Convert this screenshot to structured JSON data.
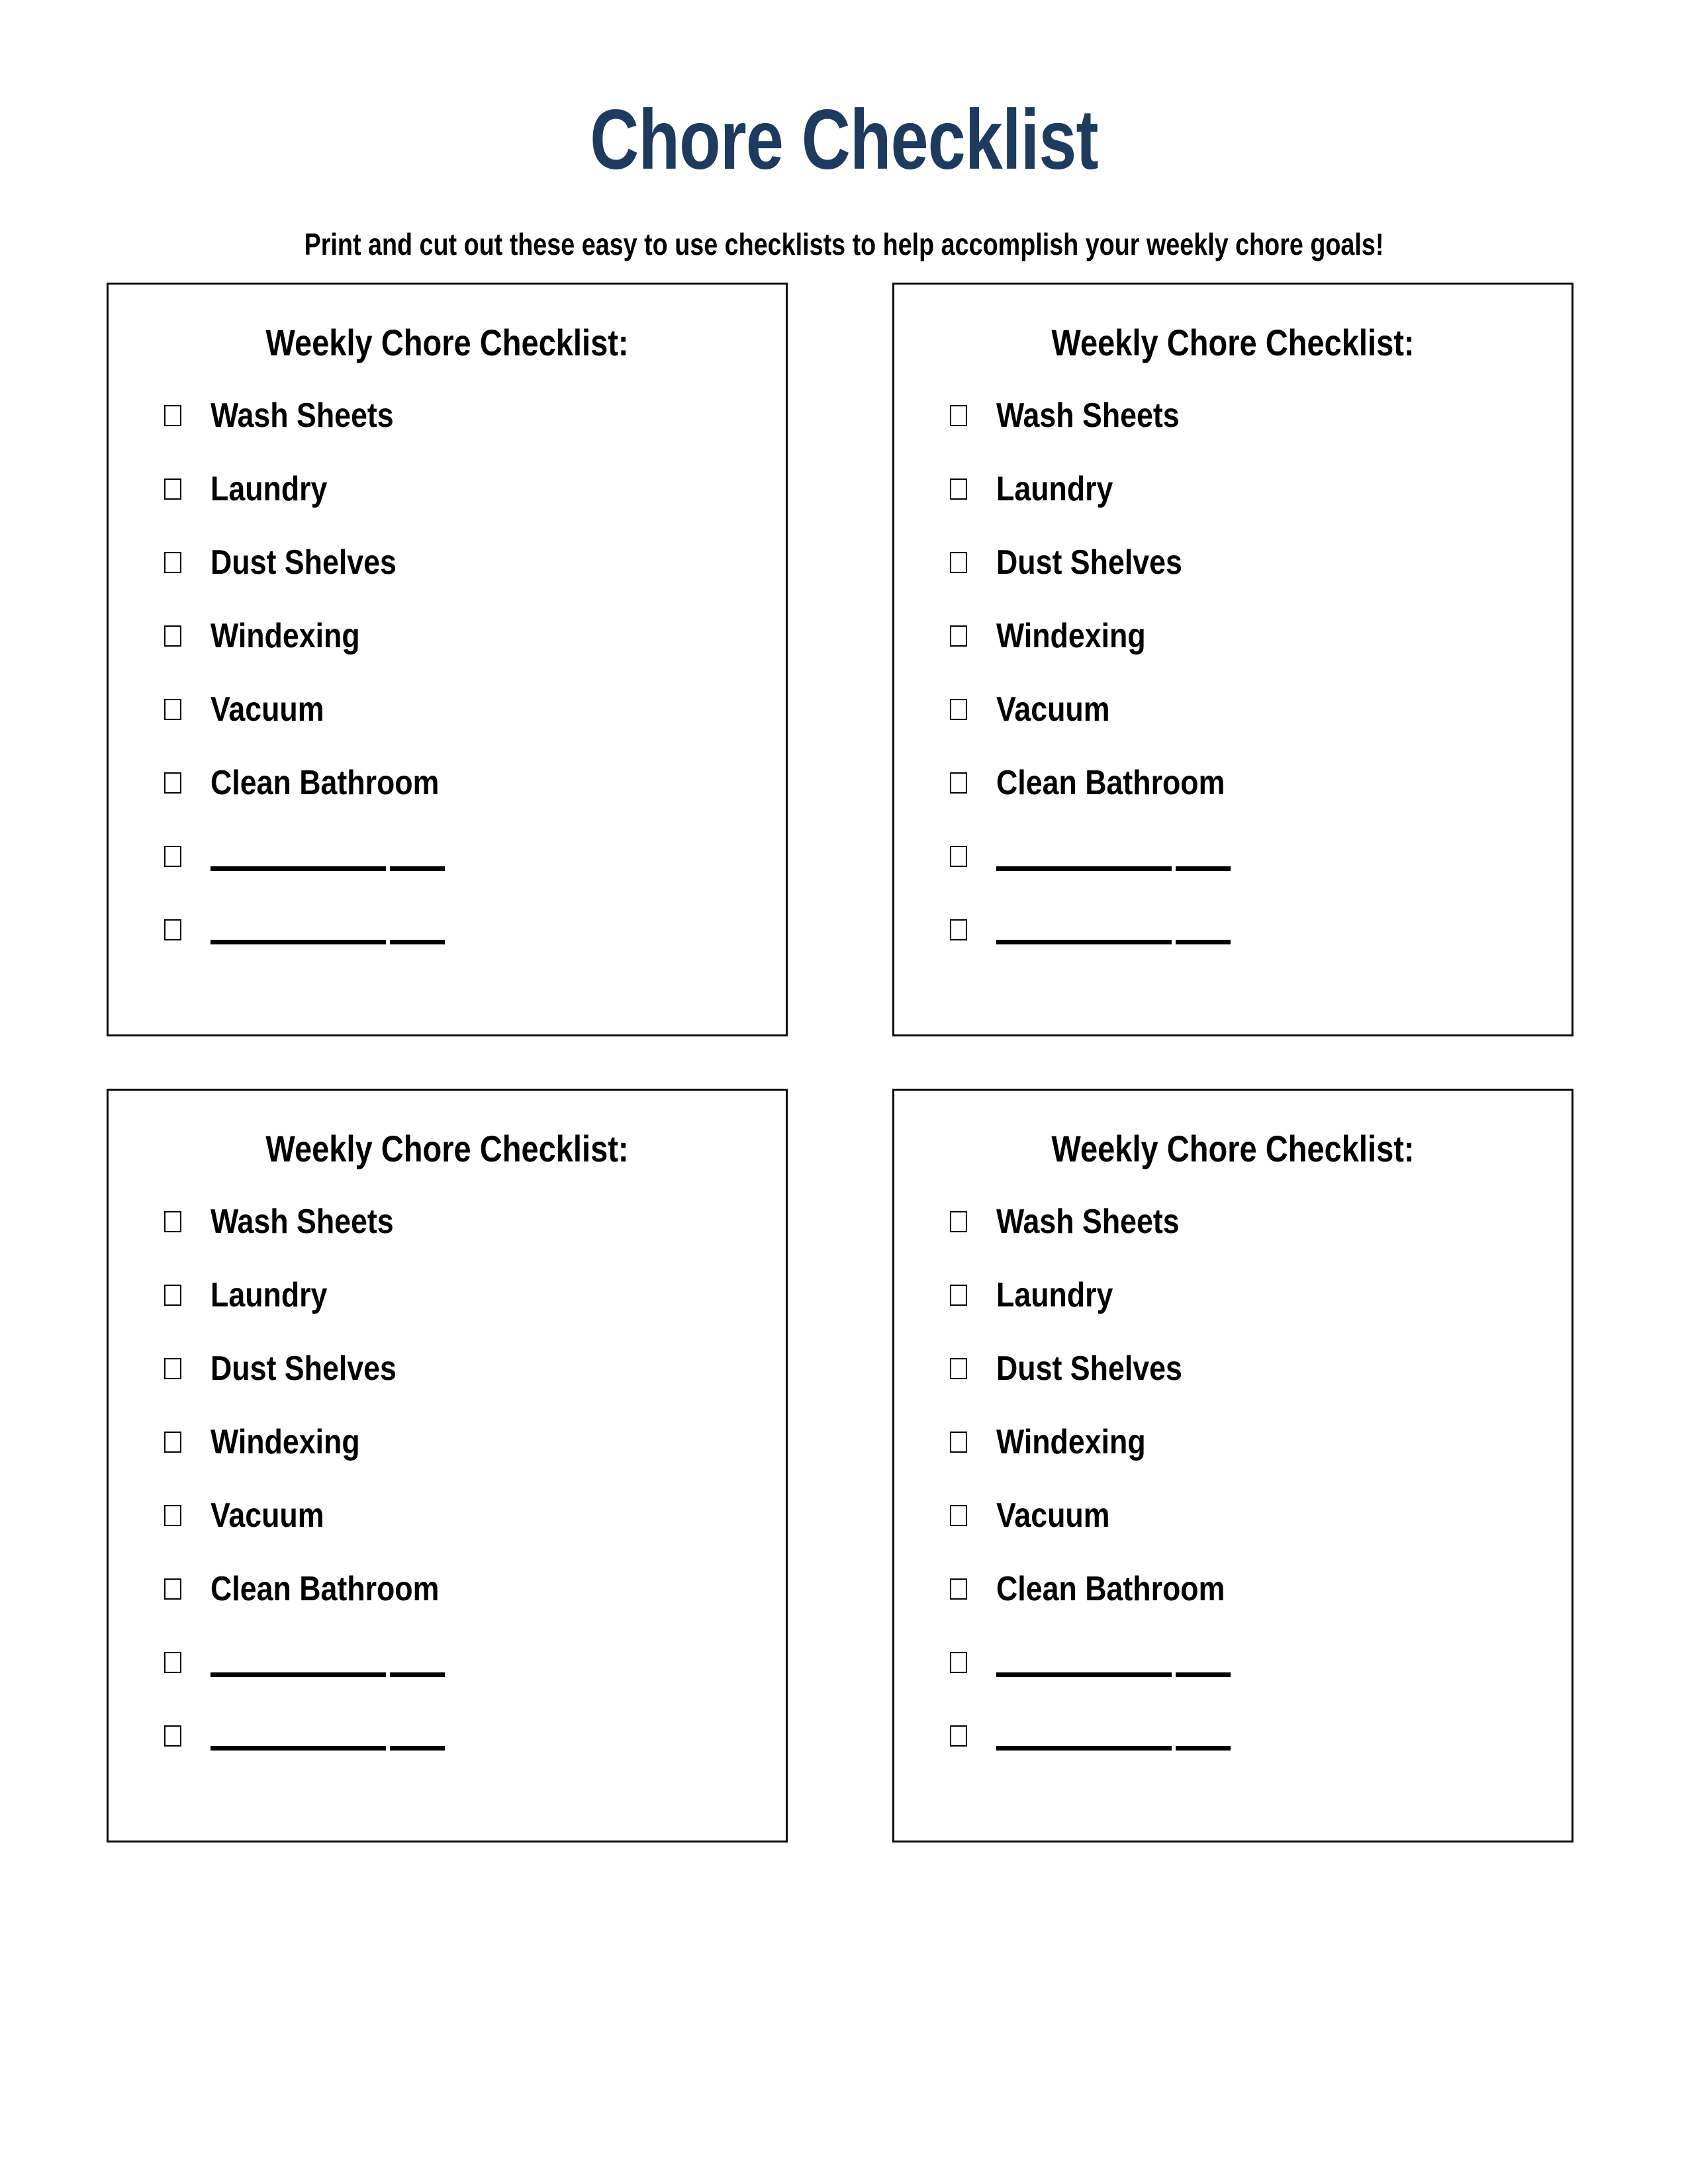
{
  "page": {
    "title": "Chore Checklist",
    "subtitle": "Print and cut out these easy to use checklists to help accomplish your weekly chore goals!",
    "title_color": "#1d3a5f",
    "text_color": "#000000",
    "border_color": "#0a0a0a",
    "background_color": "#ffffff"
  },
  "checklist_template": {
    "heading": "Weekly Chore Checklist:",
    "items": [
      {
        "label": "Wash Sheets",
        "type": "labeled",
        "checked": false
      },
      {
        "label": "Laundry",
        "type": "labeled",
        "checked": false
      },
      {
        "label": "Dust Shelves",
        "type": "labeled",
        "checked": false
      },
      {
        "label": "Windexing",
        "type": "labeled",
        "checked": false
      },
      {
        "label": "Vacuum",
        "type": "labeled",
        "checked": false
      },
      {
        "label": "Clean Bathroom",
        "type": "labeled",
        "checked": false
      },
      {
        "label": "______________",
        "type": "blank",
        "checked": false
      },
      {
        "label": "______________",
        "type": "blank",
        "checked": false
      }
    ]
  },
  "cards": [
    {
      "id": "card-1",
      "heading": "Weekly Chore Checklist:",
      "items": [
        {
          "label": "Wash Sheets"
        },
        {
          "label": "Laundry"
        },
        {
          "label": "Dust Shelves"
        },
        {
          "label": "Windexing"
        },
        {
          "label": "Vacuum"
        },
        {
          "label": "Clean Bathroom"
        },
        {
          "label": ""
        },
        {
          "label": ""
        }
      ]
    },
    {
      "id": "card-2",
      "heading": "Weekly Chore Checklist:",
      "items": [
        {
          "label": "Wash Sheets"
        },
        {
          "label": "Laundry"
        },
        {
          "label": "Dust Shelves"
        },
        {
          "label": "Windexing"
        },
        {
          "label": "Vacuum"
        },
        {
          "label": "Clean Bathroom"
        },
        {
          "label": ""
        },
        {
          "label": ""
        }
      ]
    },
    {
      "id": "card-3",
      "heading": "Weekly Chore Checklist:",
      "items": [
        {
          "label": "Wash Sheets"
        },
        {
          "label": "Laundry"
        },
        {
          "label": "Dust Shelves"
        },
        {
          "label": "Windexing"
        },
        {
          "label": "Vacuum"
        },
        {
          "label": "Clean Bathroom"
        },
        {
          "label": ""
        },
        {
          "label": ""
        }
      ]
    },
    {
      "id": "card-4",
      "heading": "Weekly Chore Checklist:",
      "items": [
        {
          "label": "Wash Sheets"
        },
        {
          "label": "Laundry"
        },
        {
          "label": "Dust Shelves"
        },
        {
          "label": "Windexing"
        },
        {
          "label": "Vacuum"
        },
        {
          "label": "Clean Bathroom"
        },
        {
          "label": ""
        },
        {
          "label": ""
        }
      ]
    }
  ]
}
